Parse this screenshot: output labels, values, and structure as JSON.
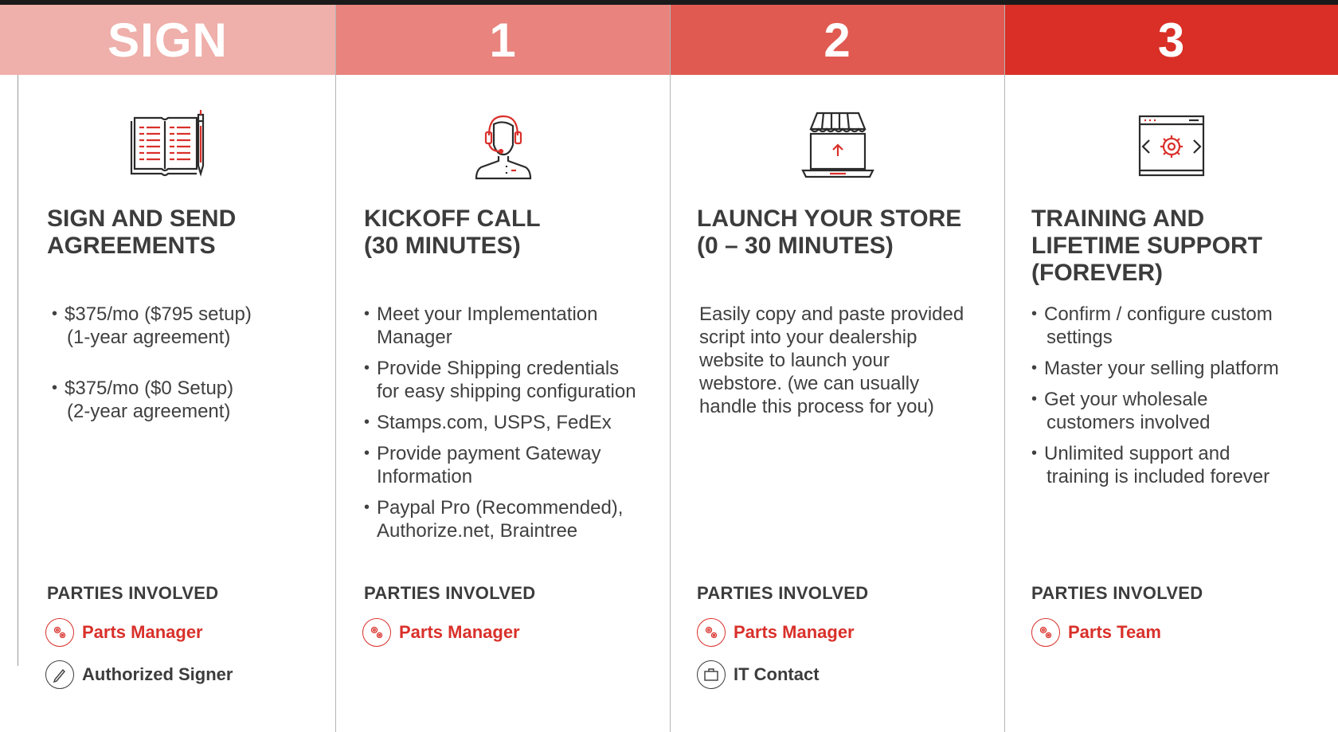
{
  "columns": [
    {
      "header": "SIGN",
      "header_color": "#efafaa",
      "icon": "open-book-pencil-icon",
      "title_lines": [
        "SIGN AND SEND",
        "AGREEMENTS"
      ],
      "bullets": [
        [
          "$375/mo ($795 setup)",
          "(1-year agreement)"
        ],
        [
          "$375/mo ($0 Setup)",
          "(2-year agreement)"
        ]
      ],
      "parties_label": "PARTIES INVOLVED",
      "parties": [
        {
          "name": "Parts Manager",
          "icon": "gears-icon",
          "accent": true
        },
        {
          "name": "Authorized Signer",
          "icon": "pen-icon",
          "accent": false
        }
      ]
    },
    {
      "header": "1",
      "header_color": "#e8837d",
      "icon": "headset-agent-icon",
      "title_lines": [
        "KICKOFF CALL",
        "(30 MINUTES)"
      ],
      "bullets": [
        [
          "Meet your Implementation",
          "Manager"
        ],
        [
          "Provide Shipping credentials",
          "for easy shipping configuration"
        ],
        [
          "Stamps.com, USPS, FedEx"
        ],
        [
          "Provide payment Gateway",
          "Information"
        ],
        [
          "Paypal Pro (Recommended),",
          "Authorize.net, Braintree"
        ]
      ],
      "parties_label": "PARTIES INVOLVED",
      "parties": [
        {
          "name": "Parts Manager",
          "icon": "gears-icon",
          "accent": true
        }
      ]
    },
    {
      "header": "2",
      "header_color": "#e05a51",
      "icon": "laptop-storefront-icon",
      "title_lines": [
        "LAUNCH YOUR STORE",
        "(0 – 30 MINUTES)"
      ],
      "description_lines": [
        "Easily copy and paste provided",
        "script into your dealership",
        "website to launch your",
        "webstore. (we can usually",
        "handle this process for you)"
      ],
      "parties_label": "PARTIES INVOLVED",
      "parties": [
        {
          "name": "Parts Manager",
          "icon": "gears-icon",
          "accent": true
        },
        {
          "name": "IT Contact",
          "icon": "briefcase-icon",
          "accent": false
        }
      ]
    },
    {
      "header": "3",
      "header_color": "#d92f26",
      "icon": "browser-gear-code-icon",
      "title_lines": [
        "TRAINING AND",
        "LIFETIME SUPPORT",
        "(FOREVER)"
      ],
      "bullets": [
        [
          "Confirm / configure custom",
          "settings"
        ],
        [
          "Master your selling platform"
        ],
        [
          "Get your wholesale",
          "customers involved"
        ],
        [
          "Unlimited support and",
          "training is included forever"
        ]
      ],
      "parties_label": "PARTIES INVOLVED",
      "parties": [
        {
          "name": "Parts Team",
          "icon": "gears-icon",
          "accent": true
        }
      ]
    }
  ],
  "colors": {
    "accent_red": "#d9302a",
    "text": "#3c3c3c",
    "divider": "#b5b5b5"
  }
}
